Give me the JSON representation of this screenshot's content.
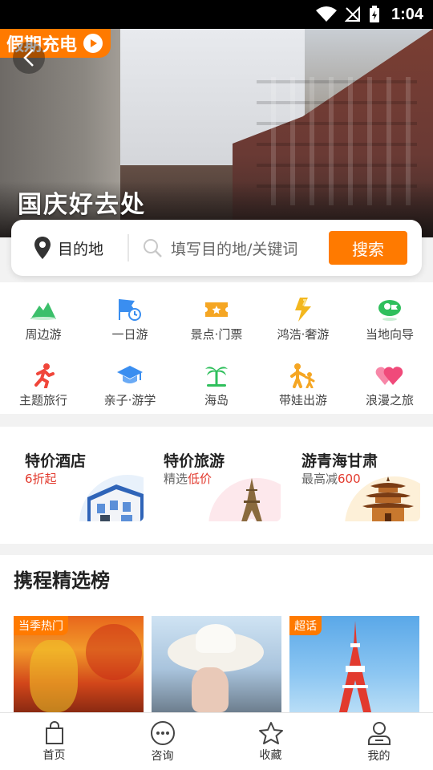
{
  "status_bar": {
    "time": "1:04"
  },
  "hero": {
    "badge": "假期充电",
    "caption": "国庆好去处"
  },
  "search": {
    "destination_label": "目的地",
    "placeholder": "填写目的地/关键词",
    "button": "搜索"
  },
  "categories": [
    {
      "label": "周边游",
      "icon": "mountain-icon",
      "color": "#3bbf6a"
    },
    {
      "label": "一日游",
      "icon": "flag-clock-icon",
      "color": "#3a8ef0"
    },
    {
      "label": "景点·门票",
      "icon": "ticket-icon",
      "color": "#f5a623"
    },
    {
      "label": "鸿浩·奢游",
      "icon": "lightning-icon",
      "color": "#f3b71e"
    },
    {
      "label": "当地向导",
      "icon": "guide-flag-icon",
      "color": "#2fbf5c"
    },
    {
      "label": "主题旅行",
      "icon": "runner-icon",
      "color": "#f0463a"
    },
    {
      "label": "亲子·游学",
      "icon": "graduation-cap-icon",
      "color": "#3a8ef0"
    },
    {
      "label": "海岛",
      "icon": "palm-tree-icon",
      "color": "#2fbf5c"
    },
    {
      "label": "带娃出游",
      "icon": "parent-child-icon",
      "color": "#f5a623"
    },
    {
      "label": "浪漫之旅",
      "icon": "hearts-icon",
      "color": "#f04a7a"
    }
  ],
  "deals": [
    {
      "title": "特价酒店",
      "sub": "6折起"
    },
    {
      "title": "特价旅游",
      "sub_prefix": "精选",
      "sub_highlight": "低价"
    },
    {
      "title": "游青海甘肃",
      "sub_prefix": "最高减",
      "sub_highlight": "600"
    }
  ],
  "ranking": {
    "title": "携程精选榜",
    "cards": [
      {
        "tag": "当季热门"
      },
      {
        "tag": ""
      },
      {
        "tag": "超话"
      }
    ]
  },
  "bottom_nav": [
    {
      "label": "首页",
      "icon": "shopping-bag-icon"
    },
    {
      "label": "咨询",
      "icon": "chat-bubble-icon"
    },
    {
      "label": "收藏",
      "icon": "star-icon"
    },
    {
      "label": "我的",
      "icon": "user-icon"
    }
  ],
  "colors": {
    "accent": "#ff7a00",
    "price_red": "#e23a2e"
  }
}
